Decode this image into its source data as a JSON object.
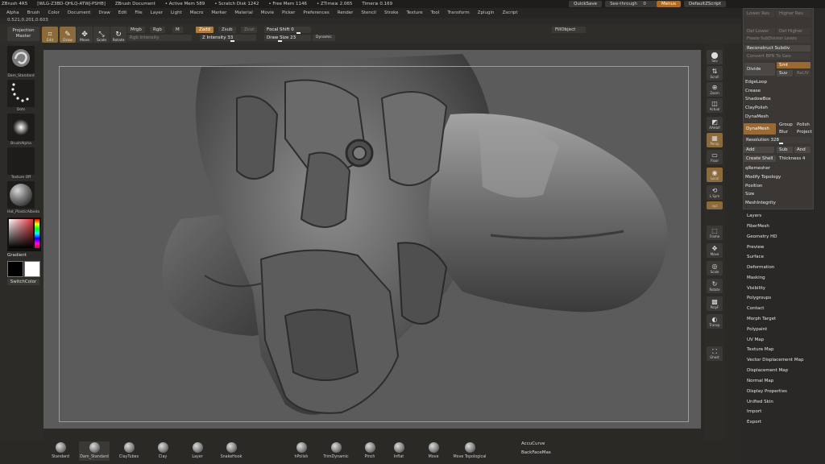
{
  "titlebar": {
    "app": "ZBrush 4R5",
    "info": "[WLG-Z3BD-QHLQ-ATWJ-PSHB]",
    "document": "ZBrush Document",
    "active_mem": "• Active Mem 589",
    "scratch_disk": "• Scratch Disk 1242",
    "free_mem": "• Free Mem 1146",
    "ztime": "• ZTime≥ 2.065",
    "timer": "Timer≥ 0.169",
    "quicksave": "QuickSave",
    "seethrough": "See-through",
    "seethrough_value": "0",
    "menus": "Menus",
    "script": "DefaultZScript"
  },
  "menubar": [
    "Alpha",
    "Brush",
    "Color",
    "Document",
    "Draw",
    "Edit",
    "File",
    "Layer",
    "Light",
    "Macro",
    "Marker",
    "Material",
    "Movie",
    "Picker",
    "Preferences",
    "Render",
    "Stencil",
    "Stroke",
    "Texture",
    "Tool",
    "Transform",
    "Zplugin",
    "Zscript"
  ],
  "coords": "0.521,0.201,0.603",
  "shelf": {
    "projection_master": [
      "Projection",
      "Master"
    ],
    "edit": "Edit",
    "draw": "Draw",
    "move": "Move",
    "scale": "Scale",
    "rotate": "Rotate",
    "mrgb": "Mrgb",
    "rgb": "Rgb",
    "m": "M",
    "zadd": "Zadd",
    "zsub": "Zsub",
    "zcut": "Zcut",
    "rgb_intensity": "Rgb  Intensity",
    "z_intensity": "Z Intensity 33",
    "focal_shift": "Focal Shift 0",
    "draw_size": "Draw Size 23",
    "dynamic": "Dynamic",
    "fillobject": "FillObject"
  },
  "lefttray": {
    "brush_label": "Dam_Standard",
    "stroke_label": "Dots",
    "alpha_label": "BrushAlpha",
    "texture_label": "Texture  Off",
    "material_label": "Hat_PlasticAlbedo",
    "gradient": "Gradient",
    "switchcolor": "SwitchColor"
  },
  "rightshelf": [
    {
      "icon": "⬤",
      "label": "Sev"
    },
    {
      "icon": "⇅",
      "label": "Scroll"
    },
    {
      "icon": "⊕",
      "label": "Zoom"
    },
    {
      "icon": "◫",
      "label": "Actual"
    },
    {
      "icon": "◩",
      "label": "AAHalf"
    },
    {
      "icon": "▦",
      "label": "Persp"
    },
    {
      "icon": "▭",
      "label": "Floor"
    },
    {
      "icon": "◉",
      "label": "Local"
    },
    {
      "icon": "⟲",
      "label": "L.Sym"
    },
    {
      "icon": "xyz",
      "label": "Xyz"
    },
    {
      "icon": "⬚",
      "label": "Frame"
    },
    {
      "icon": "✥",
      "label": "Move"
    },
    {
      "icon": "◎",
      "label": "Scale"
    },
    {
      "icon": "↻",
      "label": "Rotate"
    },
    {
      "icon": "▩",
      "label": "PolyF"
    },
    {
      "icon": "◐",
      "label": "Transp"
    },
    {
      "icon": "⛶",
      "label": "Ghost"
    }
  ],
  "palette": {
    "lower_res": "Lower Res",
    "higher_res": "Higher Res",
    "del_lower": "Del Lower",
    "del_higher": "Del Higher",
    "freeze_subdiv": "Freeze SubDivision Levels",
    "reconstruct": "Reconstruct Subdiv",
    "convert_bpr": "Convert BPR To Geo",
    "divide": "Divide",
    "smt": "Smt",
    "suv": "Suv",
    "reuv": "ReUV",
    "edgeloop": "EdgeLoop",
    "crease": "Crease",
    "shadowbox": "ShadowBox",
    "claypolish": "ClayPolish",
    "dynamesh_header": "DynaMesh",
    "dynamesh_btn": "DynaMesh",
    "group": "Group",
    "polish": "Polish",
    "blur": "Blur",
    "project": "Project",
    "resolution": "Resolution 328",
    "add": "Add",
    "sub": "Sub",
    "and": "And",
    "create_shell": "Create Shell",
    "thickness": "Thickness 4",
    "qremesher": "qRemesher",
    "modify_topology": "Modify Topology",
    "position": "Position",
    "size": "Size",
    "meshintegrity": "MeshIntegrity",
    "sections": [
      "Layers",
      "FiberMesh",
      "Geometry HD",
      "Preview",
      "Surface",
      "Deformation",
      "Masking",
      "Visibility",
      "Polygroups",
      "Contact",
      "Morph Target",
      "Polypaint",
      "UV Map",
      "Texture Map",
      "Vector Displacement Map",
      "Displacement Map",
      "Normal Map",
      "Display Properties",
      "Unified Skin",
      "Import",
      "Export"
    ]
  },
  "bottom": {
    "brushes": [
      "Standard",
      "Dam_Standard",
      "ClayTubes",
      "Clay",
      "Layer",
      "SnakeHook",
      "hPolish",
      "TrimDynamic",
      "Pinch",
      "Inflat",
      "Move",
      "Move Topological"
    ],
    "accucurve": "AccuCurve",
    "backfacemask": "BackFaceMas"
  },
  "colors": {
    "accent": "#b57a34",
    "canvas_bg": "#5b5b5b",
    "panel_bg": "#2a2826"
  }
}
